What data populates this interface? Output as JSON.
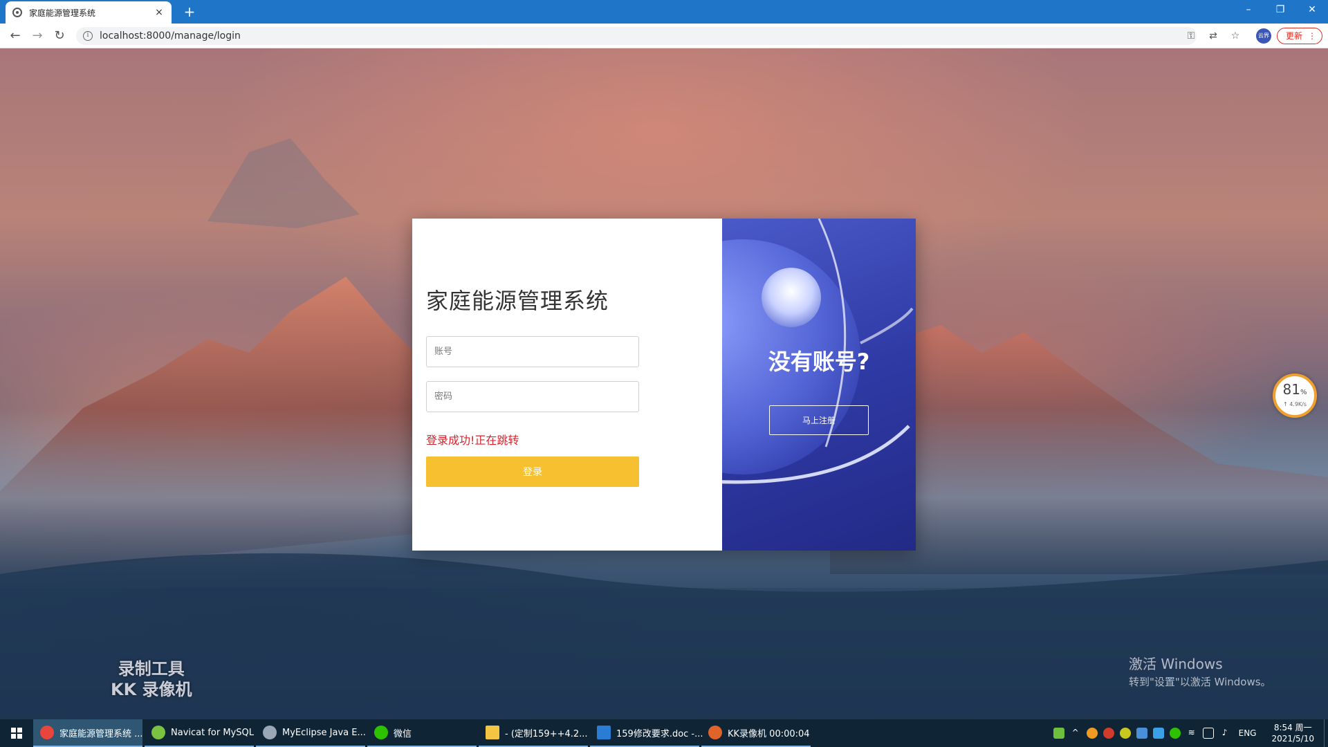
{
  "browser": {
    "tab_title": "家庭能源管理系统",
    "tab_close": "×",
    "new_tab": "+",
    "url": "localhost:8000/manage/login",
    "update_label": "更新",
    "profile_label": "云界",
    "minimize": "–",
    "restore": "❐",
    "close": "✕"
  },
  "login": {
    "system_title": "家庭能源管理系统",
    "account_placeholder": "账号",
    "password_placeholder": "密码",
    "status_message": "登录成功!正在跳转",
    "login_button": "登录"
  },
  "register_panel": {
    "heading": "没有账号?",
    "register_button": "马上注册"
  },
  "overlays": {
    "recorder_watermark_line1": "录制工具",
    "recorder_watermark_line2": "KK 录像机",
    "activate_title": "激活 Windows",
    "activate_hint": "转到\"设置\"以激活 Windows。",
    "speed_percent": "81",
    "speed_unit": "%",
    "speed_rate": "↑ 4.9K/s"
  },
  "taskbar": {
    "items": [
      {
        "label": "家庭能源管理系统 ...",
        "color": "#e8453c"
      },
      {
        "label": "Navicat for MySQL",
        "color": "#7cc242"
      },
      {
        "label": "MyEclipse Java E...",
        "color": "#9aa7b5"
      },
      {
        "label": "微信",
        "color": "#2dc100"
      },
      {
        "label": "- (定制159++4.2...",
        "color": "#f4c542"
      },
      {
        "label": "159修改要求.doc -...",
        "color": "#2b7cd3"
      },
      {
        "label": "KK录像机 00:00:04",
        "color": "#e0642a"
      }
    ],
    "language": "ENG",
    "time": "8:54 周一",
    "date": "2021/5/10"
  },
  "colors": {
    "tabbar": "#1f76c9",
    "login_button": "#f7c030",
    "status_message": "#d8222b",
    "panel_blue": "#2f3aa5"
  }
}
